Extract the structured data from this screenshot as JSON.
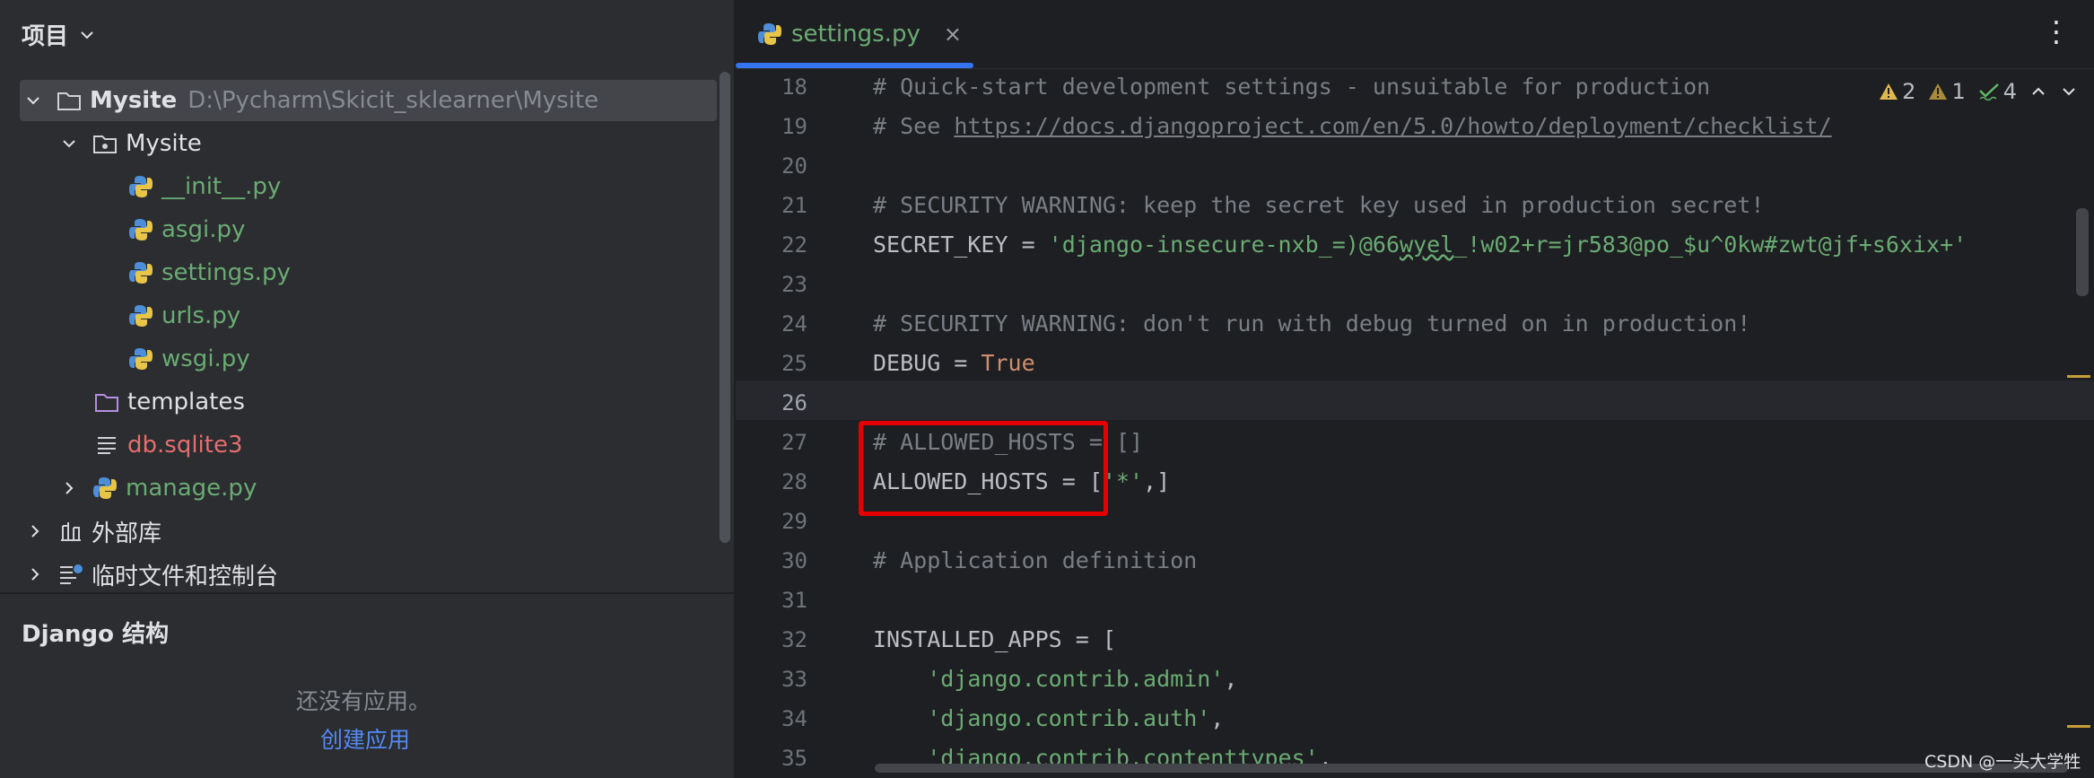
{
  "project_panel": {
    "title": "项目",
    "tree": [
      {
        "label": "Mysite",
        "path": "D:\\Pycharm\\Skicit_sklearner\\Mysite"
      },
      {
        "label": "Mysite"
      },
      {
        "label": "__init__.py"
      },
      {
        "label": "asgi.py"
      },
      {
        "label": "settings.py"
      },
      {
        "label": "urls.py"
      },
      {
        "label": "wsgi.py"
      },
      {
        "label": "templates"
      },
      {
        "label": "db.sqlite3"
      },
      {
        "label": "manage.py"
      },
      {
        "label": "外部库"
      },
      {
        "label": "临时文件和控制台"
      }
    ]
  },
  "django_panel": {
    "title": "Django 结构",
    "empty_message": "还没有应用。",
    "create_link": "创建应用"
  },
  "editor": {
    "tab_label": "settings.py",
    "close_glyph": "×",
    "menu_glyph": "⋮",
    "inspections": {
      "warnings": "2",
      "weak_warnings": "1",
      "checks": "4"
    },
    "line_numbers": [
      "18",
      "19",
      "20",
      "21",
      "22",
      "23",
      "24",
      "25",
      "26",
      "27",
      "28",
      "29",
      "30",
      "31",
      "32",
      "33",
      "34",
      "35"
    ],
    "lines": {
      "l18": "# Quick-start development settings - unsuitable for production",
      "l19_prefix": "# See ",
      "l19_link": "https://docs.djangoproject.com/en/5.0/howto/deployment/checklist/",
      "l21": "# SECURITY WARNING: keep the secret key used in production secret!",
      "l22_key": "SECRET_KEY = ",
      "l22_val_a": "'django-insecure-nxb_=)@66",
      "l22_val_b": "wyel",
      "l22_val_c": "_!w02+r=jr583@po_$u^0kw#zwt@jf+s6xix+'",
      "l24": "# SECURITY WARNING: don't run with debug turned on in production!",
      "l25_key": "DEBUG = ",
      "l25_val": "True",
      "l27": "# ALLOWED_HOSTS = []",
      "l28_a": "ALLOWED_HOSTS = [",
      "l28_str": "'*'",
      "l28_b": ",]",
      "l30": "# Application definition",
      "l32": "INSTALLED_APPS = [",
      "l33_str": "'django.contrib.admin'",
      "l34_str": "'django.contrib.auth'",
      "l35_str": "'django.contrib.contenttypes'",
      "comma": ","
    }
  },
  "watermark": "CSDN @一头大学牲",
  "colors": {
    "panel_bg": "#2b2d30",
    "editor_bg": "#1e1f22",
    "green_file": "#6aab73",
    "red_file": "#e66d6d",
    "comment": "#7a7e85",
    "keyword": "#cf8e6d",
    "link": "#548af7",
    "tab_accent": "#3574f0",
    "highlight_box": "#e50000",
    "warning": "#e0b94c"
  }
}
